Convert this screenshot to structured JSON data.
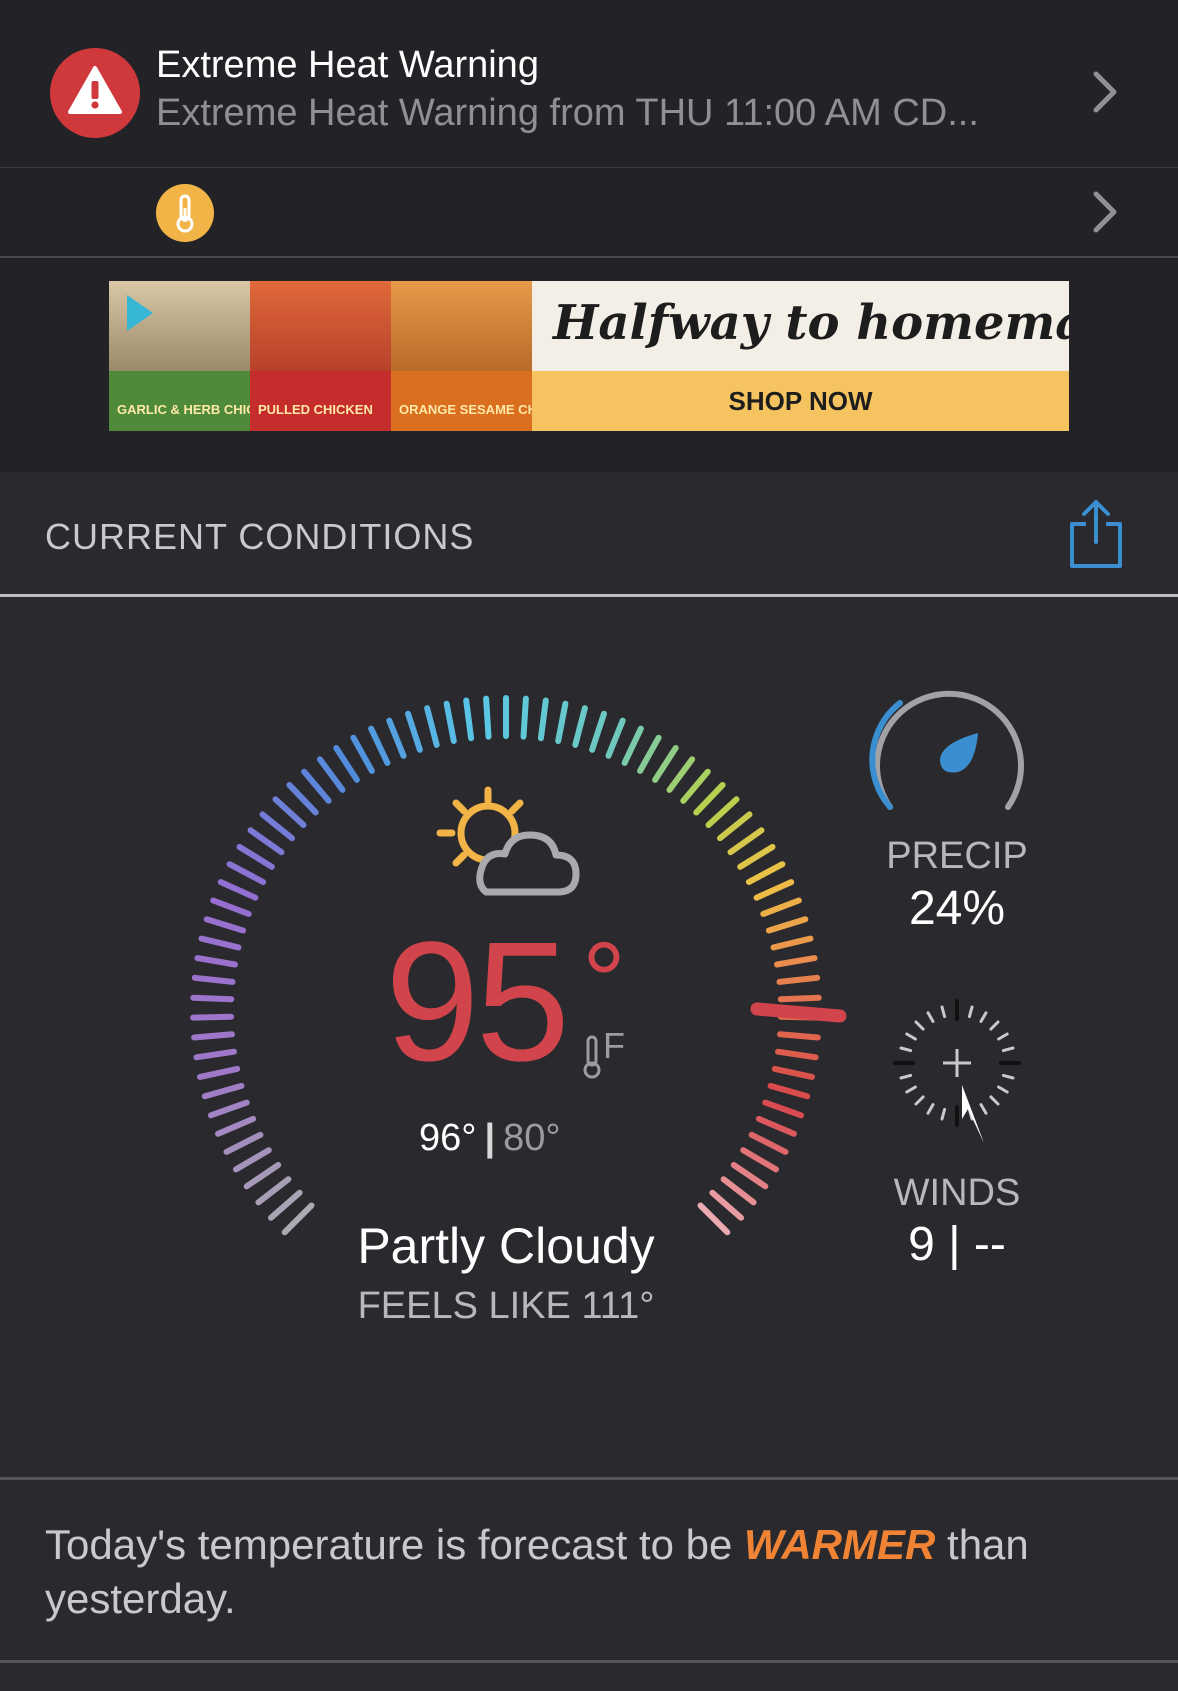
{
  "alert": {
    "title": "Extreme Heat Warning",
    "subtitle": "Extreme Heat Warning from THU 11:00 AM CD...",
    "icon": "warning-icon",
    "color": "#d0393c"
  },
  "temperature_alert": {
    "icon": "thermometer-icon",
    "color": "#f2b447"
  },
  "ad": {
    "tagline": "Halfway to homemade",
    "cta": "SHOP NOW",
    "products": [
      "GARLIC & HERB CHICKEN",
      "PULLED CHICKEN",
      "ORANGE SESAME CHICKEN"
    ]
  },
  "current_conditions": {
    "title": "CURRENT CONDITIONS",
    "share_icon": "share-icon"
  },
  "weather": {
    "temperature": "95",
    "degree_symbol": "°",
    "unit": "F",
    "high": "96°",
    "separator": "|",
    "low": "80°",
    "condition": "Partly Cloudy",
    "feels_like": "FEELS LIKE 111°",
    "condition_icon": "partly-cloudy-icon",
    "temp_color": "#d2444b"
  },
  "precip": {
    "label": "PRECIP",
    "value": "24%",
    "icon": "raindrop-icon"
  },
  "winds": {
    "label": "WINDS",
    "value": "9 | --",
    "icon": "compass-icon"
  },
  "forecast_note": {
    "before": "Today's temperature is forecast to be ",
    "highlight": "WARMER",
    "after": " than yesterday.",
    "highlight_color": "#f08434"
  }
}
